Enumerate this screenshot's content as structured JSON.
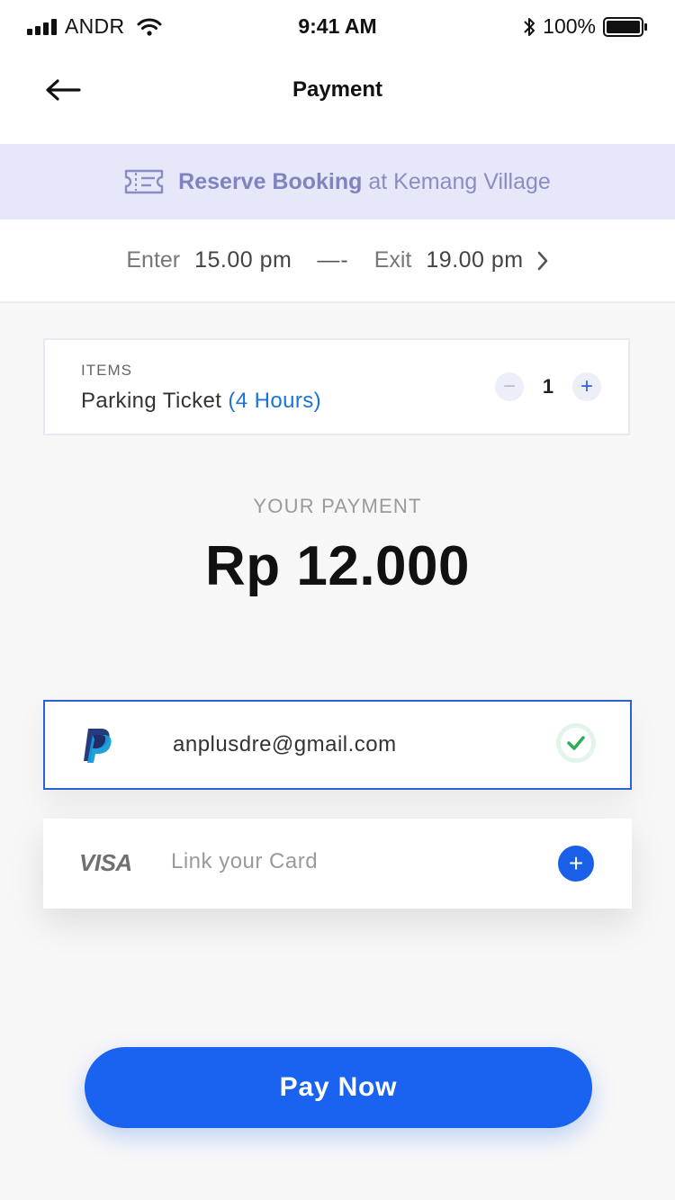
{
  "status_bar": {
    "carrier": "ANDR",
    "time": "9:41 AM",
    "battery": "100%"
  },
  "nav": {
    "title": "Payment",
    "back_icon": "arrow-left-icon"
  },
  "banner": {
    "icon": "ticket-icon",
    "strong": "Reserve Booking",
    "rest": " at Kemang Village"
  },
  "time_range": {
    "enter_label": "Enter",
    "enter_value": "15.00 pm",
    "separator": "—-",
    "exit_label": "Exit",
    "exit_value": "19.00 pm"
  },
  "items": {
    "label": "ITEMS",
    "name": "Parking Ticket",
    "duration": "(4 Hours)",
    "quantity": "1",
    "minus": "−",
    "plus": "+"
  },
  "payment": {
    "label": "YOUR PAYMENT",
    "amount": "Rp 12.000"
  },
  "methods": {
    "paypal": {
      "icon": "paypal-icon",
      "account": "anplusdre@gmail.com",
      "selected": true
    },
    "visa": {
      "logo": "VISA",
      "text": "Link your Card",
      "add": "+"
    }
  },
  "pay_button": "Pay Now",
  "colors": {
    "primary": "#1a62f0",
    "banner_bg": "#e6e7f8",
    "banner_text": "#8a8dc4",
    "duration": "#1a73d9",
    "check": "#2eae5b"
  }
}
